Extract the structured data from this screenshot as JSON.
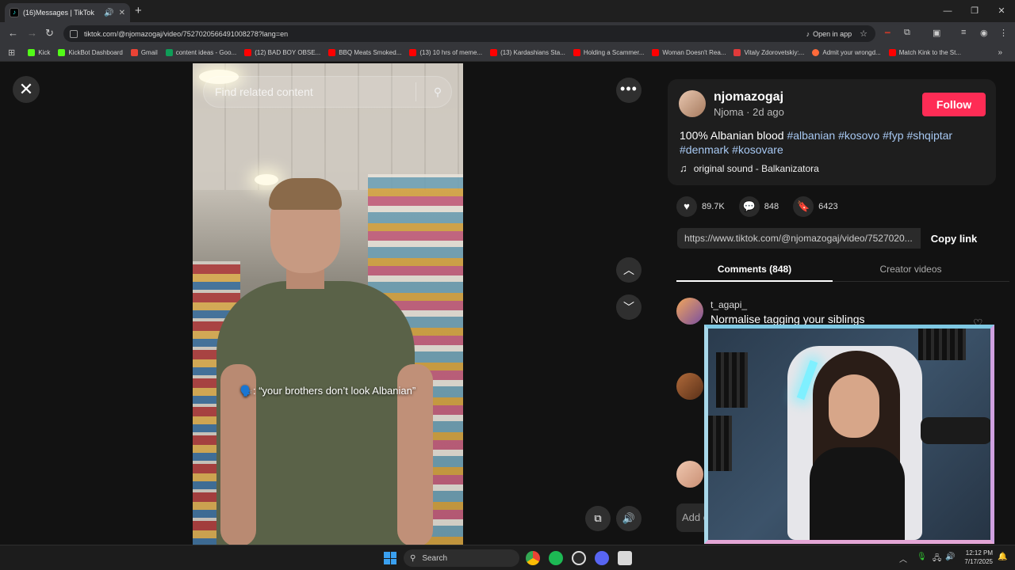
{
  "browser": {
    "tab_title": "(16)Messages | TikTok",
    "url": "tiktok.com/@njomazogaj/video/7527020566491008278?lang=en",
    "open_in_app": "Open in app",
    "bookmarks": [
      {
        "label": "Kick",
        "color": "#53fc18"
      },
      {
        "label": "KickBot Dashboard",
        "color": "#53fc18"
      },
      {
        "label": "Gmail",
        "color": "#ea4335"
      },
      {
        "label": "content ideas - Goo...",
        "color": "#0f9d58"
      },
      {
        "label": "(12) BAD BOY OBSE...",
        "color": "#ff0000"
      },
      {
        "label": "BBQ Meats Smoked...",
        "color": "#ff0000"
      },
      {
        "label": "(13) 10 hrs of meme...",
        "color": "#ff0000"
      },
      {
        "label": "(13) Kardashians Sta...",
        "color": "#ff0000"
      },
      {
        "label": "Holding a Scammer...",
        "color": "#ff0000"
      },
      {
        "label": "Woman Doesn't Rea...",
        "color": "#ff0000"
      },
      {
        "label": "Vitaly Zdorovetskiy:...",
        "color": "#e03a3a"
      },
      {
        "label": "Admit your wrongd...",
        "color": "#ff6a3a"
      },
      {
        "label": "Match Kink to the St...",
        "color": "#ff0000"
      }
    ]
  },
  "video": {
    "search_placeholder": "Find related content",
    "caption": "🗣️: “your brothers don’t look Albanian”"
  },
  "author": {
    "username": "njomazogaj",
    "subtitle": "Njoma · 2d ago",
    "follow_label": "Follow"
  },
  "post": {
    "text": "100% Albanian blood",
    "hashtags": [
      "#albanian",
      "#kosovo",
      "#fyp",
      "#shqiptar",
      "#denmark",
      "#kosovare"
    ],
    "music": "original sound - Balkanizatora"
  },
  "stats": {
    "likes": "89.7K",
    "comments": "848",
    "saves": "6423"
  },
  "share": {
    "link": "https://www.tiktok.com/@njomazogaj/video/7527020...",
    "copy_label": "Copy link"
  },
  "tabs": {
    "comments": "Comments (848)",
    "creator": "Creator videos"
  },
  "comments": [
    {
      "user": "t_agapi_",
      "text": "Normalise tagging your siblings"
    }
  ],
  "add_comment_placeholder": "Add c",
  "taskbar": {
    "search_label": "Search",
    "time": "12:12 PM",
    "date": "7/17/2025"
  },
  "colors": {
    "follow": "#fe2c55",
    "hashtag": "#a7c8f2",
    "background": "#121212"
  }
}
